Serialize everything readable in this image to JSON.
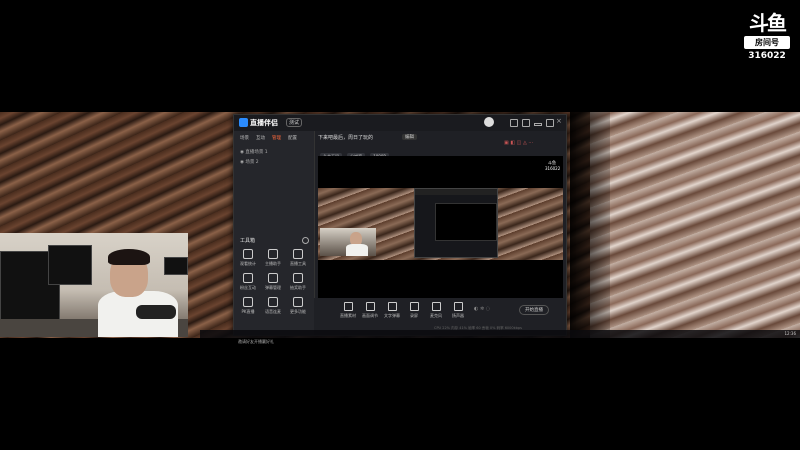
{
  "watermark": {
    "logo": "斗鱼",
    "room_label": "房间号",
    "room_number": "316022"
  },
  "obs": {
    "app_name": "直播伴侣",
    "version": "测试",
    "tabs": [
      "场景",
      "互动",
      "管理",
      "配置"
    ],
    "scenes": [
      "直播场景 1",
      "场景 2"
    ],
    "toolbox_title": "工具箱",
    "tools": [
      {
        "label": "观看统计",
        "icon": "chart-icon"
      },
      {
        "label": "主播助手",
        "icon": "user-icon"
      },
      {
        "label": "直播工具",
        "icon": "bag-icon"
      },
      {
        "label": "粉丝互动",
        "icon": "heart-icon"
      },
      {
        "label": "弹幕管理",
        "icon": "chat-icon"
      },
      {
        "label": "抽奖助手",
        "icon": "gift-icon"
      },
      {
        "label": "PK直播",
        "icon": "swords-icon"
      },
      {
        "label": "语音连麦",
        "icon": "mic-icon"
      },
      {
        "label": "更多功能",
        "icon": "grid-icon"
      }
    ],
    "invite_tip": "邀请好友开播赢好礼",
    "room_title": "下来吧最后，周日了玩的",
    "edit_label": "编辑",
    "category_label": "游戏分类",
    "chips": [
      "永劫无间",
      "分辨率",
      "1080P"
    ],
    "bottom_tools": [
      "直播素材",
      "画面调节",
      "文字弹幕",
      "录屏",
      "麦克风",
      "扬声器"
    ],
    "start_live_label": "开始直播",
    "status_text": "CPU 22%  内存 41%  帧率 60  丢帧 0%  码率 6000kbps"
  },
  "taskbar": {
    "clock": "12:36"
  }
}
